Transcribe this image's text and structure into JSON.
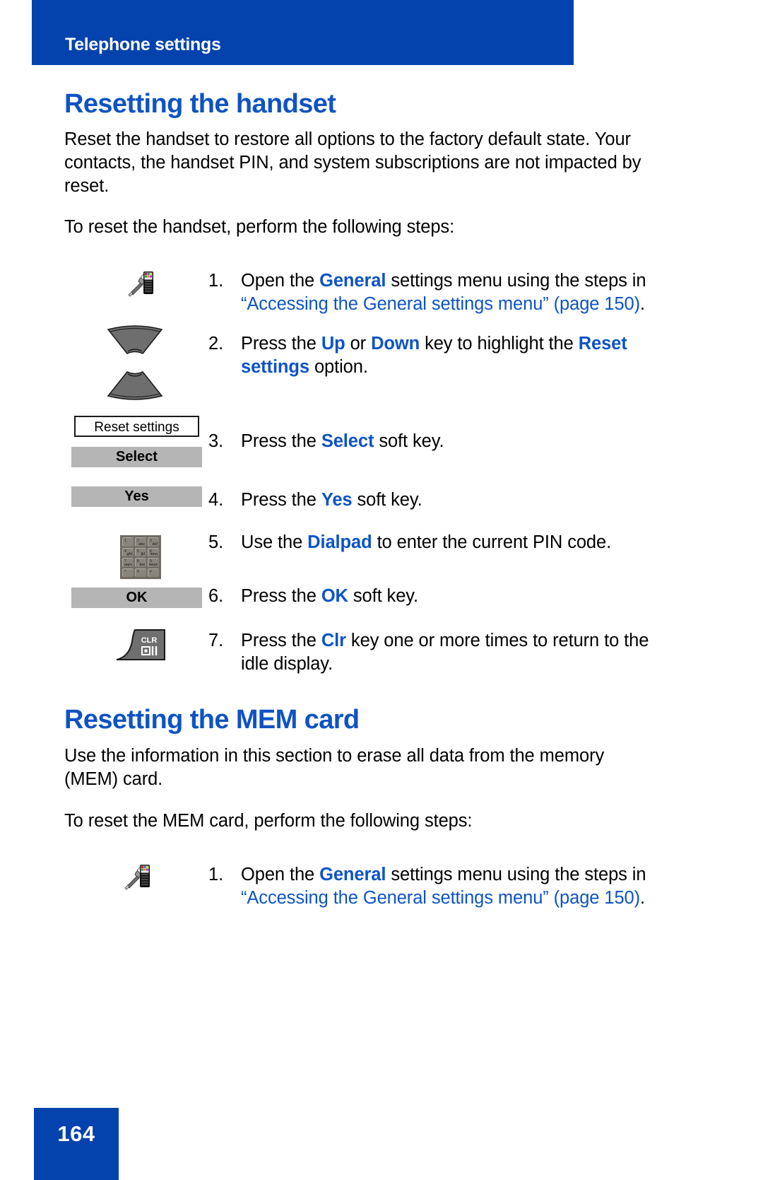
{
  "header": {
    "running_title": "Telephone settings"
  },
  "footer": {
    "page_number": "164"
  },
  "sections": [
    {
      "heading": "Resetting the handset",
      "intro_paragraph": "Reset the handset to restore all options to the factory default state. Your contacts, the handset PIN, and system subscriptions are not impacted by reset.",
      "lead_in": "To reset the handset, perform the following steps:"
    },
    {
      "heading": "Resetting the MEM card",
      "intro_paragraph": "Use the information in this section to erase all data from the memory (MEM) card.",
      "lead_in": "To reset the MEM card, perform the following steps:"
    }
  ],
  "steps_handset": [
    {
      "number": "1.",
      "text_parts": {
        "p1": "Open the ",
        "bold1": "General",
        "p2": " settings menu using the steps in ",
        "link": "“Accessing the General settings menu” (page 150)",
        "p3": "."
      },
      "icon": "general-settings-icon"
    },
    {
      "number": "2.",
      "text_parts": {
        "p1": "Press the ",
        "bold1": "Up",
        "p2": " or ",
        "bold2": "Down",
        "p3": " key to highlight the ",
        "bold3": "Reset settings",
        "p4": " option."
      },
      "icon": "up-down-navigation-keys-icon"
    },
    {
      "number": "3.",
      "text_parts": {
        "p1": "Press the ",
        "bold1": "Select",
        "p2": " soft key."
      },
      "icon": "select-softkey-icon"
    },
    {
      "number": "4.",
      "text_parts": {
        "p1": "Press the ",
        "bold1": "Yes",
        "p2": " soft key."
      },
      "icon": "yes-softkey-icon"
    },
    {
      "number": "5.",
      "text_parts": {
        "p1": "Use the ",
        "bold1": "Dialpad",
        "p2": " to enter the current PIN code."
      },
      "icon": "dialpad-icon"
    },
    {
      "number": "6.",
      "text_parts": {
        "p1": "Press the ",
        "bold1": "OK",
        "p2": " soft key."
      },
      "icon": "ok-softkey-icon"
    },
    {
      "number": "7.",
      "text_parts": {
        "p1": "Press the ",
        "bold1": "Clr",
        "p2": " key one or more times to return to the idle display."
      },
      "icon": "clr-key-icon"
    }
  ],
  "steps_mem": [
    {
      "number": "1.",
      "text_parts": {
        "p1": "Open the ",
        "bold1": "General",
        "p2": " settings menu using the steps in ",
        "link": "“Accessing the General settings menu” (page 150)",
        "p3": "."
      },
      "icon": "general-settings-icon"
    }
  ],
  "ui_artifacts": {
    "menu_item_label": "Reset settings",
    "softkey_select": "Select",
    "softkey_yes": "Yes",
    "softkey_ok": "OK",
    "clr_key_label": "CLR",
    "dialpad_keys": [
      {
        "digit": "1",
        "letters": ""
      },
      {
        "digit": "2",
        "letters": "abc"
      },
      {
        "digit": "3",
        "letters": "def"
      },
      {
        "digit": "4",
        "letters": "ghi"
      },
      {
        "digit": "5",
        "letters": "jkl"
      },
      {
        "digit": "6",
        "letters": "mno"
      },
      {
        "digit": "7",
        "letters": "pqrs"
      },
      {
        "digit": "8",
        "letters": "tuv"
      },
      {
        "digit": "9",
        "letters": "wxyz"
      },
      {
        "digit": "*",
        "letters": ""
      },
      {
        "digit": "0",
        "letters": ""
      },
      {
        "digit": "#",
        "letters": ""
      }
    ]
  },
  "colors": {
    "banner_blue": "#0442ad",
    "heading_blue": "#0e53c4",
    "link_blue": "#0d53c6",
    "softkey_gray": "#b5b5b5"
  }
}
